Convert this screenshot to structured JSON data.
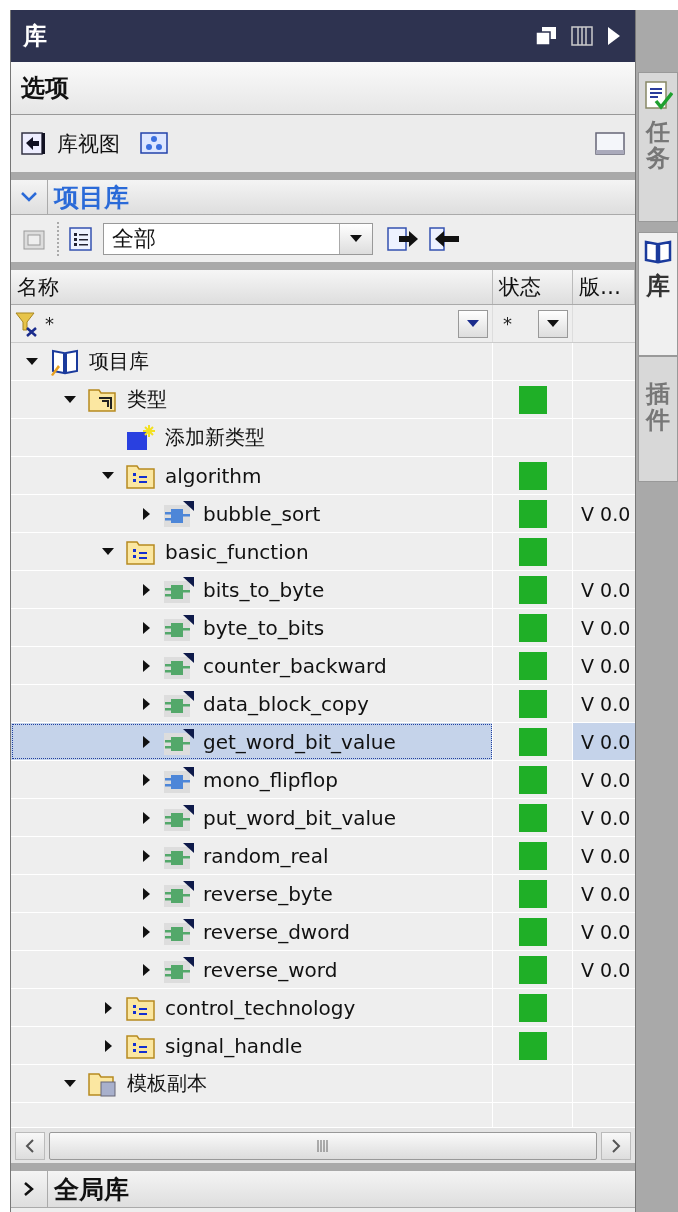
{
  "panel": {
    "title": "库"
  },
  "options": {
    "title": "选项"
  },
  "toolbar": {
    "label": "库视图"
  },
  "project_library": {
    "title": "项目库",
    "expanded": true,
    "filter": {
      "value": "全部"
    },
    "columns": [
      "名称",
      "状态",
      "版…"
    ],
    "filter_row": {
      "name": "*",
      "status": "*"
    },
    "tree": [
      {
        "kind": "library",
        "label": "项目库",
        "expanded": true,
        "selected": false,
        "children": [
          {
            "kind": "types",
            "label": "类型",
            "expanded": true,
            "selected": false,
            "color": "#1faf27",
            "children": [
              {
                "kind": "add",
                "label": "添加新类型",
                "selected": false
              },
              {
                "kind": "group",
                "label": "algorithm",
                "expanded": true,
                "selected": false,
                "color": "#1faf27",
                "children": [
                  {
                    "kind": "fb",
                    "label": "bubble_sort",
                    "expanded": false,
                    "selected": false,
                    "color": "#1faf27",
                    "version": "V 0.0"
                  }
                ]
              },
              {
                "kind": "group",
                "label": "basic_function",
                "expanded": true,
                "selected": false,
                "color": "#1faf27",
                "children": [
                  {
                    "kind": "fc",
                    "label": "bits_to_byte",
                    "expanded": false,
                    "selected": false,
                    "color": "#1faf27",
                    "version": "V 0.0"
                  },
                  {
                    "kind": "fc",
                    "label": "byte_to_bits",
                    "expanded": false,
                    "selected": false,
                    "color": "#1faf27",
                    "version": "V 0.0"
                  },
                  {
                    "kind": "fc",
                    "label": "counter_backward",
                    "expanded": false,
                    "selected": false,
                    "color": "#1faf27",
                    "version": "V 0.0"
                  },
                  {
                    "kind": "fc",
                    "label": "data_block_copy",
                    "expanded": false,
                    "selected": false,
                    "color": "#1faf27",
                    "version": "V 0.0"
                  },
                  {
                    "kind": "fc",
                    "label": "get_word_bit_value",
                    "expanded": false,
                    "selected": true,
                    "color": "#1faf27",
                    "version": "V 0.0"
                  },
                  {
                    "kind": "fb",
                    "label": "mono_flipflop",
                    "expanded": false,
                    "selected": false,
                    "color": "#1faf27",
                    "version": "V 0.0"
                  },
                  {
                    "kind": "fc",
                    "label": "put_word_bit_value",
                    "expanded": false,
                    "selected": false,
                    "color": "#1faf27",
                    "version": "V 0.0"
                  },
                  {
                    "kind": "fc",
                    "label": "random_real",
                    "expanded": false,
                    "selected": false,
                    "color": "#1faf27",
                    "version": "V 0.0"
                  },
                  {
                    "kind": "fc",
                    "label": "reverse_byte",
                    "expanded": false,
                    "selected": false,
                    "color": "#1faf27",
                    "version": "V 0.0"
                  },
                  {
                    "kind": "fc",
                    "label": "reverse_dword",
                    "expanded": false,
                    "selected": false,
                    "color": "#1faf27",
                    "version": "V 0.0"
                  },
                  {
                    "kind": "fc",
                    "label": "reverse_word",
                    "expanded": false,
                    "selected": false,
                    "color": "#1faf27",
                    "version": "V 0.0"
                  }
                ]
              },
              {
                "kind": "group",
                "label": "control_technology",
                "expanded": false,
                "selected": false,
                "color": "#1faf27"
              },
              {
                "kind": "group",
                "label": "signal_handle",
                "expanded": false,
                "selected": false,
                "color": "#1faf27"
              }
            ]
          },
          {
            "kind": "template",
            "label": "模板副本",
            "expanded": true,
            "selected": false
          }
        ]
      }
    ]
  },
  "global_library": {
    "title": "全局库",
    "expanded": false
  },
  "side_tabs": [
    {
      "label": "任务",
      "selected": false
    },
    {
      "label": "库",
      "selected": true
    },
    {
      "label": "插件",
      "selected": false
    }
  ]
}
